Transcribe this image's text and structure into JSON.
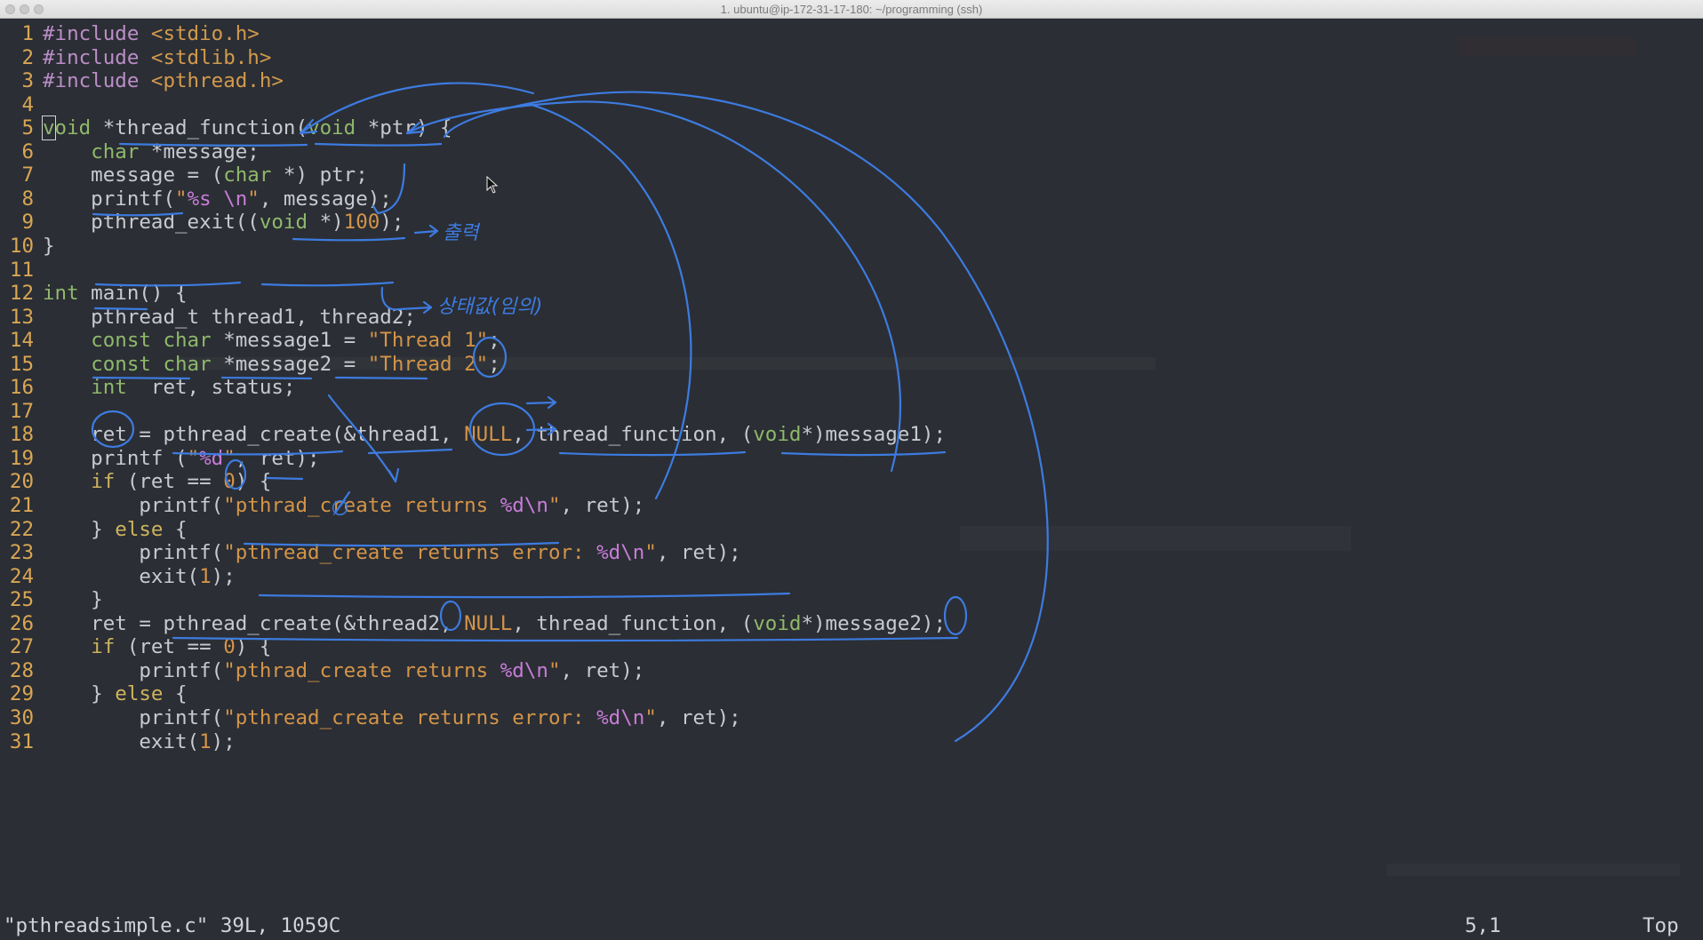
{
  "window": {
    "title": "1. ubuntu@ip-172-31-17-180: ~/programming (ssh)"
  },
  "code": {
    "lines": [
      {
        "n": "1",
        "tokens": [
          {
            "t": "#include ",
            "c": "pre"
          },
          {
            "t": "<stdio.h>",
            "c": "hdr"
          }
        ]
      },
      {
        "n": "2",
        "tokens": [
          {
            "t": "#include ",
            "c": "pre"
          },
          {
            "t": "<stdlib.h>",
            "c": "hdr"
          }
        ]
      },
      {
        "n": "3",
        "tokens": [
          {
            "t": "#include ",
            "c": "pre"
          },
          {
            "t": "<pthread.h>",
            "c": "hdr"
          }
        ]
      },
      {
        "n": "4",
        "tokens": []
      },
      {
        "n": "5",
        "tokens": [
          {
            "t": "v",
            "c": "typ cursor"
          },
          {
            "t": "oid",
            "c": "typ"
          },
          {
            "t": " *thread_function(",
            "c": "fn"
          },
          {
            "t": "void",
            "c": "typ"
          },
          {
            "t": " *ptr) {",
            "c": "fn"
          }
        ]
      },
      {
        "n": "6",
        "tokens": [
          {
            "t": "    ",
            "c": "fn"
          },
          {
            "t": "char",
            "c": "typ"
          },
          {
            "t": " *message;",
            "c": "fn"
          }
        ]
      },
      {
        "n": "7",
        "tokens": [
          {
            "t": "    message = (",
            "c": "fn"
          },
          {
            "t": "char",
            "c": "typ"
          },
          {
            "t": " *) ptr;",
            "c": "fn"
          }
        ]
      },
      {
        "n": "8",
        "tokens": [
          {
            "t": "    printf(",
            "c": "fn"
          },
          {
            "t": "\"",
            "c": "str"
          },
          {
            "t": "%s",
            "c": "fmt"
          },
          {
            "t": " ",
            "c": "str"
          },
          {
            "t": "\\n",
            "c": "fmt"
          },
          {
            "t": "\"",
            "c": "str"
          },
          {
            "t": ", message);",
            "c": "fn"
          }
        ]
      },
      {
        "n": "9",
        "tokens": [
          {
            "t": "    pthread_exit((",
            "c": "fn"
          },
          {
            "t": "void",
            "c": "typ"
          },
          {
            "t": " *)",
            "c": "fn"
          },
          {
            "t": "100",
            "c": "num"
          },
          {
            "t": ");",
            "c": "fn"
          }
        ]
      },
      {
        "n": "10",
        "tokens": [
          {
            "t": "}",
            "c": "fn"
          }
        ]
      },
      {
        "n": "11",
        "tokens": []
      },
      {
        "n": "12",
        "tokens": [
          {
            "t": "int",
            "c": "typ"
          },
          {
            "t": " main() {",
            "c": "fn"
          }
        ]
      },
      {
        "n": "13",
        "tokens": [
          {
            "t": "    pthread_t thread1, thread2;",
            "c": "fn"
          }
        ]
      },
      {
        "n": "14",
        "tokens": [
          {
            "t": "    ",
            "c": "fn"
          },
          {
            "t": "const",
            "c": "typ"
          },
          {
            "t": " ",
            "c": "fn"
          },
          {
            "t": "char",
            "c": "typ"
          },
          {
            "t": " *message1 = ",
            "c": "fn"
          },
          {
            "t": "\"Thread 1\"",
            "c": "str"
          },
          {
            "t": ";",
            "c": "fn"
          }
        ]
      },
      {
        "n": "15",
        "tokens": [
          {
            "t": "    ",
            "c": "fn"
          },
          {
            "t": "const",
            "c": "typ"
          },
          {
            "t": " ",
            "c": "fn"
          },
          {
            "t": "char",
            "c": "typ"
          },
          {
            "t": " *message2 = ",
            "c": "fn"
          },
          {
            "t": "\"Thread 2\"",
            "c": "str"
          },
          {
            "t": ";",
            "c": "fn"
          }
        ]
      },
      {
        "n": "16",
        "tokens": [
          {
            "t": "    ",
            "c": "fn"
          },
          {
            "t": "int",
            "c": "typ"
          },
          {
            "t": "  ret, status;",
            "c": "fn"
          }
        ]
      },
      {
        "n": "17",
        "tokens": []
      },
      {
        "n": "18",
        "tokens": [
          {
            "t": "    ret = pthread_create(&thread1, ",
            "c": "fn"
          },
          {
            "t": "NULL",
            "c": "num"
          },
          {
            "t": ", thread_function, (",
            "c": "fn"
          },
          {
            "t": "void",
            "c": "typ"
          },
          {
            "t": "*)message1);",
            "c": "fn"
          }
        ]
      },
      {
        "n": "19",
        "tokens": [
          {
            "t": "    printf (",
            "c": "fn"
          },
          {
            "t": "\"",
            "c": "str"
          },
          {
            "t": "%d",
            "c": "fmt"
          },
          {
            "t": "\"",
            "c": "str"
          },
          {
            "t": ", ret);",
            "c": "fn"
          }
        ]
      },
      {
        "n": "20",
        "tokens": [
          {
            "t": "    ",
            "c": "fn"
          },
          {
            "t": "if",
            "c": "kw"
          },
          {
            "t": " (ret == ",
            "c": "fn"
          },
          {
            "t": "0",
            "c": "num"
          },
          {
            "t": ") {",
            "c": "fn"
          }
        ]
      },
      {
        "n": "21",
        "tokens": [
          {
            "t": "        printf(",
            "c": "fn"
          },
          {
            "t": "\"pthrad_create returns ",
            "c": "str"
          },
          {
            "t": "%d\\n",
            "c": "fmt"
          },
          {
            "t": "\"",
            "c": "str"
          },
          {
            "t": ", ret);",
            "c": "fn"
          }
        ]
      },
      {
        "n": "22",
        "tokens": [
          {
            "t": "    } ",
            "c": "fn"
          },
          {
            "t": "else",
            "c": "kw"
          },
          {
            "t": " {",
            "c": "fn"
          }
        ]
      },
      {
        "n": "23",
        "tokens": [
          {
            "t": "        printf(",
            "c": "fn"
          },
          {
            "t": "\"pthread_create returns error: ",
            "c": "str"
          },
          {
            "t": "%d\\n",
            "c": "fmt"
          },
          {
            "t": "\"",
            "c": "str"
          },
          {
            "t": ", ret);",
            "c": "fn"
          }
        ]
      },
      {
        "n": "24",
        "tokens": [
          {
            "t": "        exit(",
            "c": "fn"
          },
          {
            "t": "1",
            "c": "num"
          },
          {
            "t": ");",
            "c": "fn"
          }
        ]
      },
      {
        "n": "25",
        "tokens": [
          {
            "t": "    }",
            "c": "fn"
          }
        ]
      },
      {
        "n": "26",
        "tokens": [
          {
            "t": "    ret = pthread_create(&thread2, ",
            "c": "fn"
          },
          {
            "t": "NULL",
            "c": "num"
          },
          {
            "t": ", thread_function, (",
            "c": "fn"
          },
          {
            "t": "void",
            "c": "typ"
          },
          {
            "t": "*)message2);",
            "c": "fn"
          }
        ]
      },
      {
        "n": "27",
        "tokens": [
          {
            "t": "    ",
            "c": "fn"
          },
          {
            "t": "if",
            "c": "kw"
          },
          {
            "t": " (ret == ",
            "c": "fn"
          },
          {
            "t": "0",
            "c": "num"
          },
          {
            "t": ") {",
            "c": "fn"
          }
        ]
      },
      {
        "n": "28",
        "tokens": [
          {
            "t": "        printf(",
            "c": "fn"
          },
          {
            "t": "\"pthrad_create returns ",
            "c": "str"
          },
          {
            "t": "%d\\n",
            "c": "fmt"
          },
          {
            "t": "\"",
            "c": "str"
          },
          {
            "t": ", ret);",
            "c": "fn"
          }
        ]
      },
      {
        "n": "29",
        "tokens": [
          {
            "t": "    } ",
            "c": "fn"
          },
          {
            "t": "else",
            "c": "kw"
          },
          {
            "t": " {",
            "c": "fn"
          }
        ]
      },
      {
        "n": "30",
        "tokens": [
          {
            "t": "        printf(",
            "c": "fn"
          },
          {
            "t": "\"pthread_create returns error: ",
            "c": "str"
          },
          {
            "t": "%d\\n",
            "c": "fmt"
          },
          {
            "t": "\"",
            "c": "str"
          },
          {
            "t": ", ret);",
            "c": "fn"
          }
        ]
      },
      {
        "n": "31",
        "tokens": [
          {
            "t": "        exit(",
            "c": "fn"
          },
          {
            "t": "1",
            "c": "num"
          },
          {
            "t": ");",
            "c": "fn"
          }
        ]
      }
    ]
  },
  "annotations": {
    "note_output": "출력",
    "note_status": "상태값(임의)",
    "note_zero": "∅",
    "ink_color": "#3d7be0"
  },
  "statusbar": {
    "file_info": "\"pthreadsimple.c\" 39L, 1059C",
    "position": "5,1",
    "scroll": "Top"
  },
  "colors": {
    "background": "#2b2e34",
    "line_number": "#d9a654",
    "preprocessor": "#bb8ec9",
    "type": "#8fb86b",
    "string": "#d39449",
    "format": "#c77cd9"
  }
}
